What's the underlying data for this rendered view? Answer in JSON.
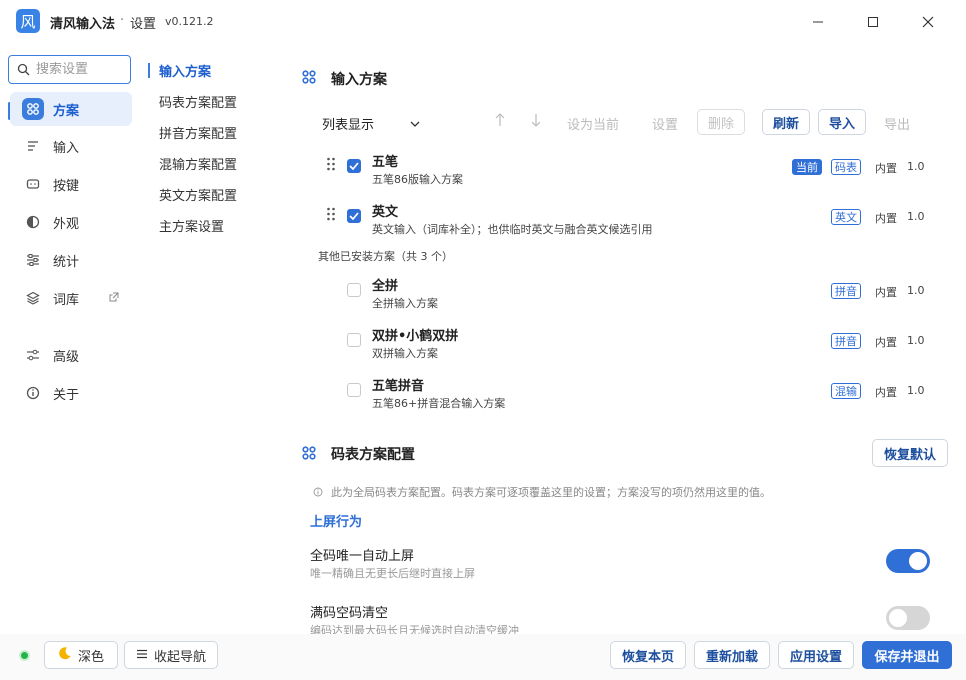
{
  "app": {
    "title": "清风输入法",
    "separator": "·",
    "subtitle": "设置",
    "version": "v0.121.2",
    "logo_char": "风"
  },
  "search": {
    "placeholder": "搜索设置"
  },
  "nav": [
    {
      "label": "方案",
      "icon": "grid-icon",
      "active": true
    },
    {
      "label": "输入",
      "icon": "lines-icon"
    },
    {
      "label": "按键",
      "icon": "keyboard-icon"
    },
    {
      "label": "外观",
      "icon": "contrast-icon"
    },
    {
      "label": "统计",
      "icon": "sliders-icon"
    },
    {
      "label": "词库",
      "icon": "layers-icon",
      "external": true
    },
    {
      "label": "高级",
      "icon": "settings-sliders-icon"
    },
    {
      "label": "关于",
      "icon": "info-icon"
    }
  ],
  "subnav": [
    "输入方案",
    "码表方案配置",
    "拼音方案配置",
    "混输方案配置",
    "英文方案配置",
    "主方案设置"
  ],
  "schemes": {
    "title": "输入方案",
    "view_select": "列表显示",
    "toolbar": {
      "set_current": "设为当前",
      "settings": "设置",
      "delete": "删除",
      "refresh": "刷新",
      "import": "导入",
      "export": "导出"
    },
    "active": [
      {
        "title": "五笔",
        "desc": "五笔86版输入方案",
        "tags": [
          "当前",
          "码表"
        ],
        "builtin": "内置",
        "version": "1.0"
      },
      {
        "title": "英文",
        "desc": "英文输入（词库补全）；也供临时英文与融合英文候选引用",
        "tags": [
          "英文"
        ],
        "builtin": "内置",
        "version": "1.0"
      }
    ],
    "others_caption": "其他已安装方案（共 3 个）",
    "others": [
      {
        "title": "全拼",
        "desc": "全拼输入方案",
        "tag": "拼音",
        "builtin": "内置",
        "version": "1.0"
      },
      {
        "title": "双拼•小鹤双拼",
        "desc": "双拼输入方案",
        "tag": "拼音",
        "builtin": "内置",
        "version": "1.0"
      },
      {
        "title": "五笔拼音",
        "desc": "五笔86+拼音混合输入方案",
        "tag": "混输",
        "builtin": "内置",
        "version": "1.0"
      }
    ]
  },
  "code_table": {
    "title": "码表方案配置",
    "restore_default": "恢复默认",
    "note": "此为全局码表方案配置。码表方案可逐项覆盖这里的设置；方案没写的项仍然用这里的值。",
    "group": "上屏行为",
    "settings": [
      {
        "title": "全码唯一自动上屏",
        "desc": "唯一精确且无更长后继时直接上屏",
        "on": true
      },
      {
        "title": "满码空码清空",
        "desc": "编码达到最大码长且无候选时自动清空缓冲",
        "on": false
      }
    ]
  },
  "bottom": {
    "dark_mode": "深色",
    "collapse_nav": "收起导航",
    "restore_page": "恢复本页",
    "reload": "重新加载",
    "apply": "应用设置",
    "save_exit": "保存并退出"
  },
  "colors": {
    "accent": "#2f6fd6",
    "status_dot": "#22b34a"
  }
}
